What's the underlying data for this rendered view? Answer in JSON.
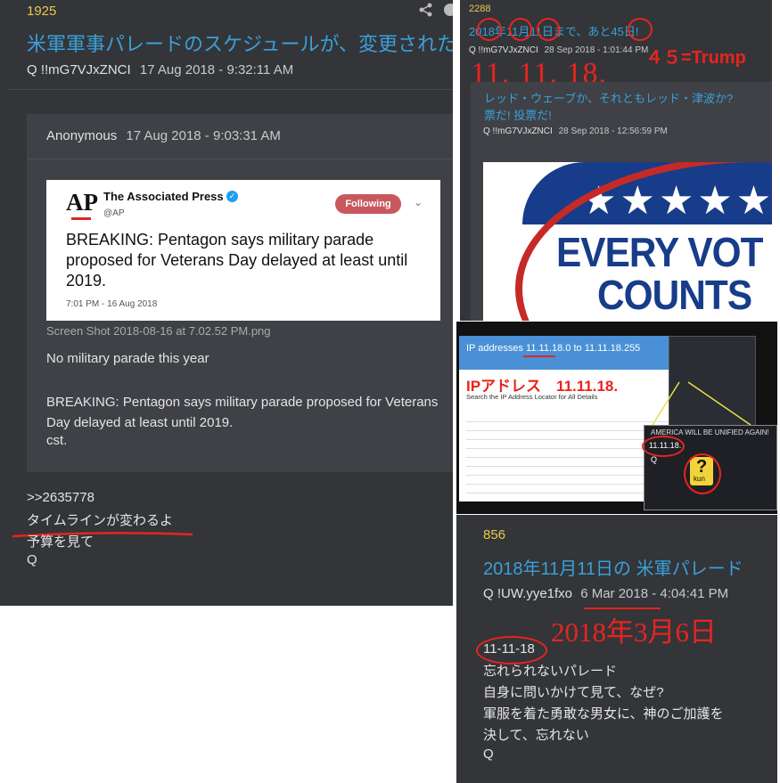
{
  "left_post": {
    "number": "1925",
    "title": "米軍軍事パレードのスケジュールが、変更された",
    "author": "Q  !!mG7VJxZNCI",
    "timestamp": "17 Aug 2018 - 9:32:11 AM",
    "quoted": {
      "author": "Anonymous",
      "timestamp": "17 Aug 2018 - 9:03:31 AM",
      "tweet": {
        "logo": "AP",
        "account_name": "The Associated Press",
        "handle": "@AP",
        "follow_label": "Following",
        "text": "BREAKING: Pentagon says military parade proposed for Veterans Day delayed at least until 2019.",
        "time": "7:01 PM - 16 Aug 2018"
      },
      "attachment": "Screen Shot 2018-08-16 at 7.02.52 PM.png",
      "body_line1": "No military parade this year",
      "body_line2": "BREAKING: Pentagon says military parade proposed for Veterans Day delayed at least until 2019.",
      "body_line3": "cst."
    },
    "reply_ref": ">>2635778",
    "reply_line1": "タイムラインが変わるよ",
    "reply_line2": "予算を見て",
    "reply_sig": "Q"
  },
  "top_right_post": {
    "number": "2288",
    "title": "2018年11月11日まで、あと45日!",
    "author": "Q  !!mG7VJxZNCI",
    "timestamp": "28 Sep 2018 - 1:01:44 PM",
    "annot_trump": "４５=Trump",
    "annot_date": "11. 11. 18.",
    "sub_title_line1": "レッド・ウェーブか、それともレッド・津波か?",
    "sub_title_line2": "票だ! 投票だ!",
    "sub_author": "Q  !!mG7VJxZNCI",
    "sub_timestamp": "28 Sep 2018 - 12:56:59 PM",
    "button_line1": "EVERY VOT",
    "button_line2": "COUNTS"
  },
  "ip_screenshot": {
    "heading": "IP addresses 11.11.18.0 to 11.11.18.255",
    "sub_heading": "Search the IP Address Locator for All Details",
    "annot": "IPアドレス　11.11.18.",
    "banner": "AMERICA WILL BE UNIFIED AGAIN!",
    "value": "11.11.18.",
    "q_letter": "Q",
    "logo": "kun"
  },
  "bottom_right_post": {
    "number": "856",
    "title": "2018年11月11日の 米軍パレード",
    "author": "Q  !UW.yye1fxo",
    "timestamp": "6 Mar 2018 - 4:04:41 PM",
    "annot_date": "2018年3月6日",
    "line_date": "11-11-18",
    "line2": "忘れられないパレード",
    "line3": "自身に問いかけて見て、なぜ?",
    "line4": "軍服を着た勇敢な男女に、神のご加護を",
    "line5": "決して、忘れない",
    "sig": "Q"
  }
}
